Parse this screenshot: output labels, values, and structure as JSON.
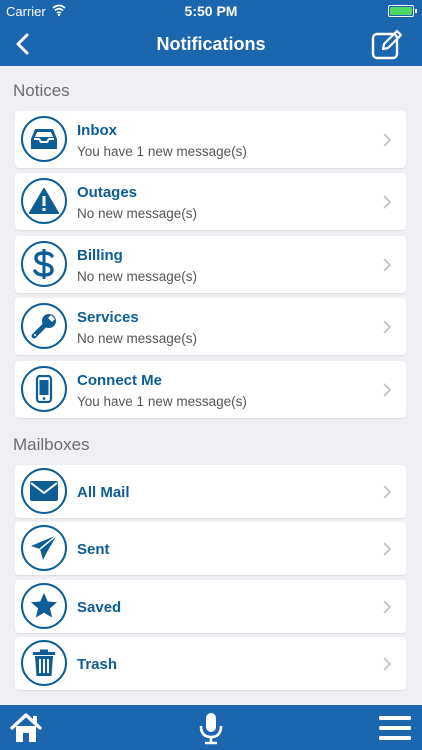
{
  "status": {
    "carrier": "Carrier",
    "time": "5:50 PM"
  },
  "nav": {
    "title": "Notifications"
  },
  "sections": {
    "notices": "Notices",
    "mailboxes": "Mailboxes"
  },
  "notices": [
    {
      "label": "Inbox",
      "sub": "You have 1 new message(s)",
      "icon": "inbox-icon"
    },
    {
      "label": "Outages",
      "sub": "No new message(s)",
      "icon": "warning-icon"
    },
    {
      "label": "Billing",
      "sub": "No new message(s)",
      "icon": "dollar-icon"
    },
    {
      "label": "Services",
      "sub": "No new message(s)",
      "icon": "wrench-icon"
    },
    {
      "label": "Connect Me",
      "sub": "You have 1 new message(s)",
      "icon": "phone-icon"
    }
  ],
  "mailboxes": [
    {
      "label": "All Mail",
      "icon": "envelope-icon"
    },
    {
      "label": "Sent",
      "icon": "paper-plane-icon"
    },
    {
      "label": "Saved",
      "icon": "star-icon"
    },
    {
      "label": "Trash",
      "icon": "trash-icon"
    }
  ],
  "colors": {
    "brand": "#1c66b0",
    "accent": "#0d5e96",
    "background": "#efeff4"
  },
  "tabbar": {
    "items": [
      "home-icon",
      "microphone-icon",
      "menu-icon"
    ]
  }
}
